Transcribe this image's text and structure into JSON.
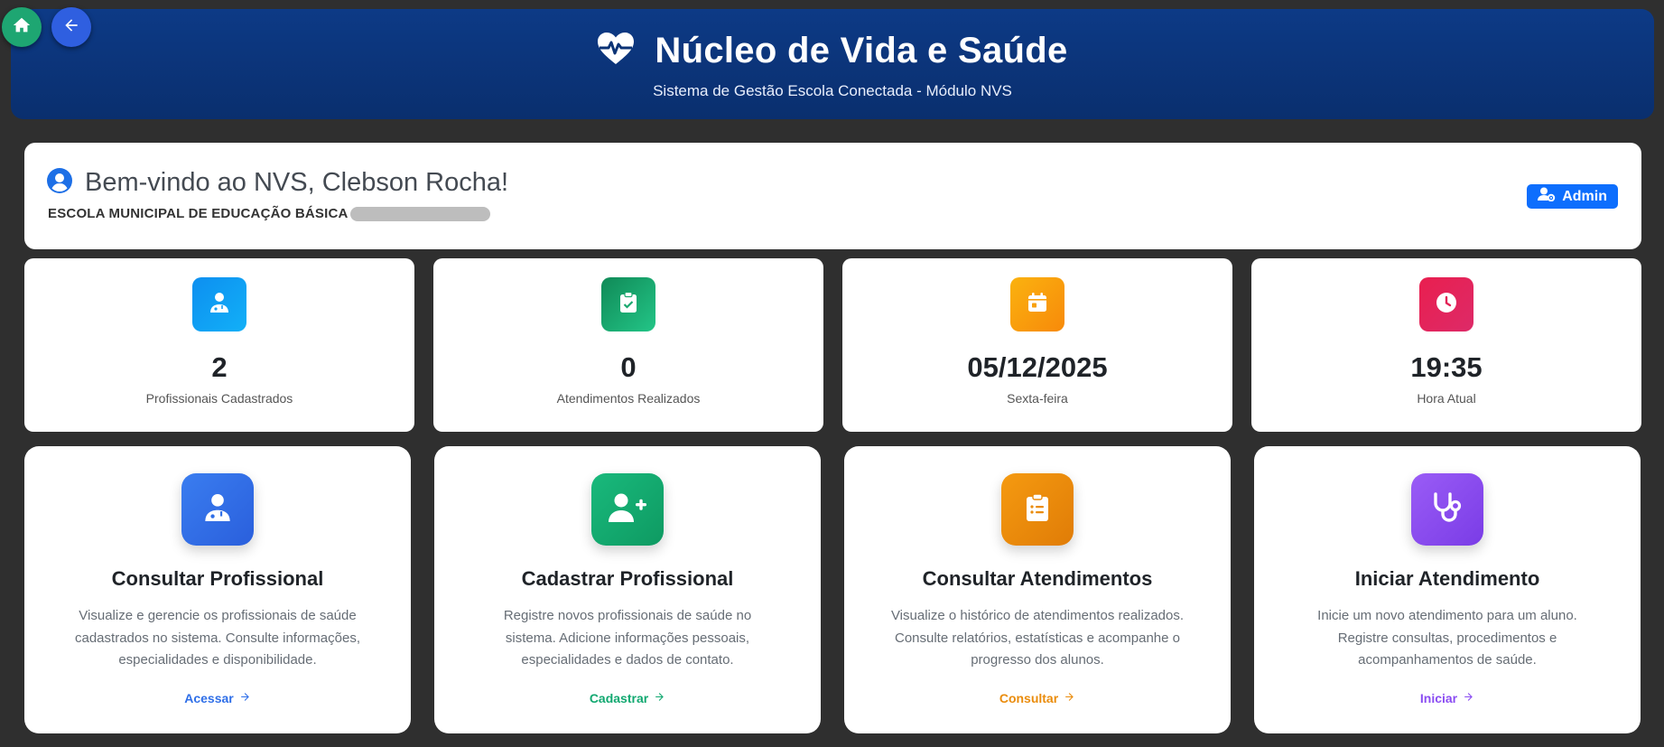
{
  "header": {
    "title": "Núcleo de Vida e Saúde",
    "subtitle": "Sistema de Gestão Escola Conectada - Módulo NVS",
    "icon": "heart-pulse-icon"
  },
  "nav": {
    "home_icon": "home-icon",
    "back_icon": "arrow-left-icon"
  },
  "welcome": {
    "greeting": "Bem-vindo ao NVS, Clebson Rocha!",
    "school": "ESCOLA MUNICIPAL DE EDUCAÇÃO BÁSICA",
    "role_badge": "Admin"
  },
  "stats": [
    {
      "value": "2",
      "label": "Profissionais Cadastrados",
      "icon": "user-doctor-icon",
      "color": "#0d8ff0"
    },
    {
      "value": "0",
      "label": "Atendimentos Realizados",
      "icon": "clipboard-check-icon",
      "color": "#149a63"
    },
    {
      "value": "05/12/2025",
      "label": "Sexta-feira",
      "icon": "calendar-icon",
      "color": "#fb9a0c"
    },
    {
      "value": "19:35",
      "label": "Hora Atual",
      "icon": "clock-icon",
      "color": "#e22356"
    }
  ],
  "actions": [
    {
      "title": "Consultar Profissional",
      "description": "Visualize e gerencie os profissionais de saúde cadastrados no sistema. Consulte informações, especialidades e disponibilidade.",
      "link": "Acessar",
      "icon": "user-doctor-icon",
      "color": "#2f6fe8"
    },
    {
      "title": "Cadastrar Profissional",
      "description": "Registre novos profissionais de saúde no sistema. Adicione informações pessoais, especialidades e dados de contato.",
      "link": "Cadastrar",
      "icon": "user-plus-icon",
      "color": "#11a870"
    },
    {
      "title": "Consultar Atendimentos",
      "description": "Visualize o histórico de atendimentos realizados. Consulte relatórios, estatísticas e acompanhe o progresso dos alunos.",
      "link": "Consultar",
      "icon": "clipboard-list-icon",
      "color": "#ea8c0c"
    },
    {
      "title": "Iniciar Atendimento",
      "description": "Inicie um novo atendimento para um aluno. Registre consultas, procedimentos e acompanhamentos de saúde.",
      "link": "Iniciar",
      "icon": "stethoscope-icon",
      "color": "#8a4cf2"
    }
  ]
}
